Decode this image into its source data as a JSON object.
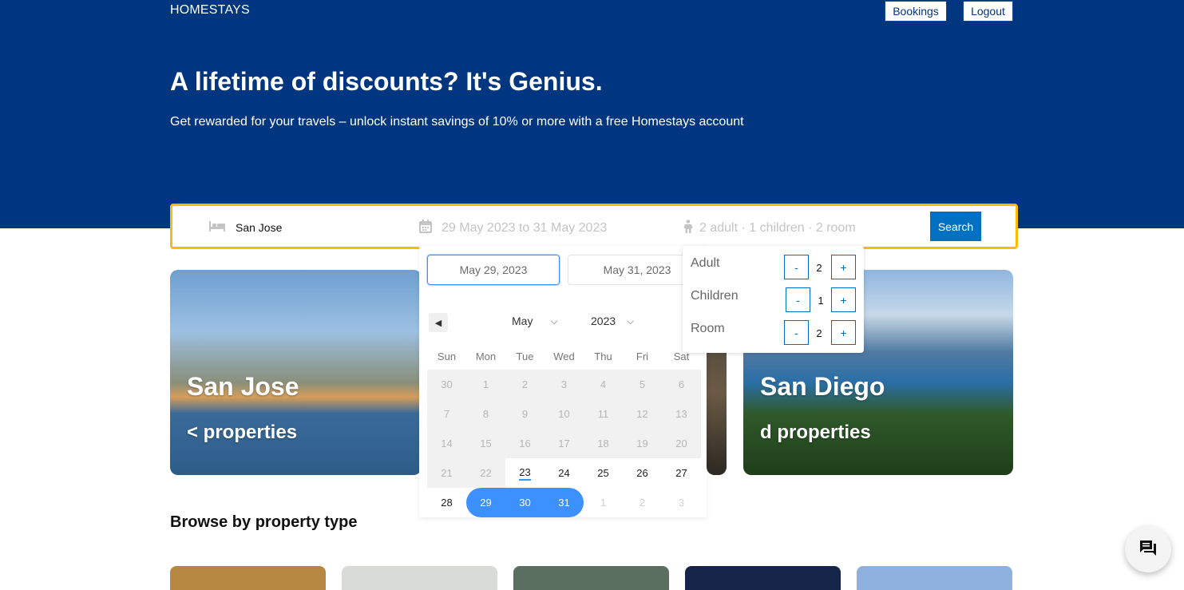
{
  "nav": {
    "brand": "HOMESTAYS",
    "bookings": "Bookings",
    "logout": "Logout"
  },
  "hero": {
    "title": "A lifetime of discounts? It's Genius.",
    "subtitle": "Get rewarded for your travels – unlock instant savings of 10% or more with a free Homestays account"
  },
  "search": {
    "destination": "San Jose",
    "dates": "29 May 2023 to 31 May 2023",
    "options": "2 adult · 1 children · 2 room",
    "button": "Search",
    "icons": {
      "bed": "bed-icon",
      "calendar": "calendar-icon",
      "person": "person-icon"
    }
  },
  "cards": [
    {
      "title": "San Jose",
      "subtitle": "< properties"
    },
    {
      "title": "San Diego",
      "subtitle": "d properties"
    }
  ],
  "section": {
    "title": "Browse by property type"
  },
  "calendar": {
    "start_date": "May 29, 2023",
    "end_date": "May 31, 2023",
    "month": "May",
    "year": "2023",
    "weekdays": [
      "Sun",
      "Mon",
      "Tue",
      "Wed",
      "Thu",
      "Fri",
      "Sat"
    ],
    "weeks": [
      [
        "30",
        "1",
        "2",
        "3",
        "4",
        "5",
        "6"
      ],
      [
        "7",
        "8",
        "9",
        "10",
        "11",
        "12",
        "13"
      ],
      [
        "14",
        "15",
        "16",
        "17",
        "18",
        "19",
        "20"
      ],
      [
        "21",
        "22",
        "23",
        "24",
        "25",
        "26",
        "27"
      ],
      [
        "28",
        "29",
        "30",
        "31",
        "1",
        "2",
        "3"
      ]
    ],
    "today": "23",
    "selected_range": [
      "29",
      "31"
    ]
  },
  "options": [
    {
      "label": "Adult",
      "value": "2",
      "minus": "-",
      "plus": "+"
    },
    {
      "label": "Children",
      "value": "1",
      "minus": "-",
      "plus": "+"
    },
    {
      "label": "Room",
      "value": "2",
      "minus": "-",
      "plus": "+"
    }
  ],
  "colors": {
    "header": "#003580",
    "accent": "#febb02",
    "primary": "#0071c2",
    "range": "#3d91ff"
  }
}
